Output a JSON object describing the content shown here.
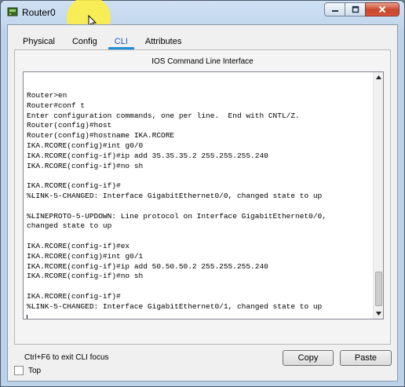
{
  "window": {
    "title": "Router0"
  },
  "tabs": [
    {
      "label": "Physical",
      "active": false
    },
    {
      "label": "Config",
      "active": false
    },
    {
      "label": "CLI",
      "active": true
    },
    {
      "label": "Attributes",
      "active": false
    }
  ],
  "cli": {
    "heading": "IOS Command Line Interface",
    "lines": [
      "Router>en",
      "Router#conf t",
      "Enter configuration commands, one per line.  End with CNTL/Z.",
      "Router(config)#host",
      "Router(config)#hostname IKA.RCORE",
      "IKA.RCORE(config)#int g0/0",
      "IKA.RCORE(config-if)#ip add 35.35.35.2 255.255.255.240",
      "IKA.RCORE(config-if)#no sh",
      "",
      "IKA.RCORE(config-if)#",
      "%LINK-5-CHANGED: Interface GigabitEthernet0/0, changed state to up",
      "",
      "%LINEPROTO-5-UPDOWN: Line protocol on Interface GigabitEthernet0/0,",
      "changed state to up",
      "",
      "IKA.RCORE(config-if)#ex",
      "IKA.RCORE(config)#int g0/1",
      "IKA.RCORE(config-if)#ip add 50.50.50.2 255.255.255.240",
      "IKA.RCORE(config-if)#no sh",
      "",
      "IKA.RCORE(config-if)#",
      "%LINK-5-CHANGED: Interface GigabitEthernet0/1, changed state to up",
      ""
    ],
    "hint": "Ctrl+F6 to exit CLI focus",
    "copy_label": "Copy",
    "paste_label": "Paste"
  },
  "footer": {
    "top_label": "Top",
    "top_checked": false
  },
  "colors": {
    "active_tab_text": "#1a5fb4",
    "active_tab_underline": "#1e8fd6",
    "close_button": "#c9452b",
    "cursor_highlight": "#fff03c"
  },
  "icons": {
    "app": "router-icon",
    "minimize": "minimize-icon",
    "maximize": "maximize-icon",
    "close": "close-icon",
    "cursor": "mouse-pointer-icon",
    "scroll_up": "scroll-up-arrow-icon",
    "scroll_down": "scroll-down-arrow-icon"
  }
}
